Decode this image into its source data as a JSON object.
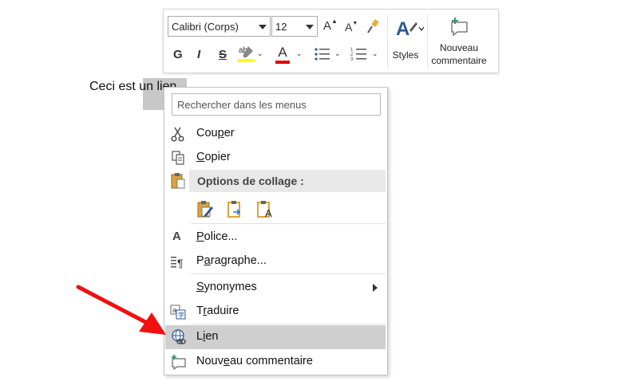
{
  "toolbar": {
    "font_name": "Calibri (Corps)",
    "font_size": "12",
    "grow_font": "A",
    "shrink_font": "A",
    "bold": "G",
    "italic": "I",
    "strike": "S",
    "font_color_letter": "A",
    "styles_label": "Styles",
    "new_comment_line1": "Nouveau",
    "new_comment_line2": "commentaire",
    "highlight_color": "#ffff00",
    "font_color": "#e00000"
  },
  "document": {
    "text_before": "Ceci est ",
    "text_selected": "un lien"
  },
  "menu": {
    "search_placeholder": "Rechercher dans les menus",
    "cut": [
      "Cou",
      "p",
      "er"
    ],
    "copy": [
      "",
      "C",
      "opier"
    ],
    "paste_header": "Options de collage :",
    "font": [
      "",
      "P",
      "olice..."
    ],
    "paragraph": [
      "P",
      "a",
      "ragraphe..."
    ],
    "synonyms": [
      "",
      "S",
      "ynonymes"
    ],
    "translate": [
      "T",
      "r",
      "aduire"
    ],
    "link": [
      "L",
      "i",
      "en"
    ],
    "new_comment": [
      "Nouv",
      "e",
      "au commentaire"
    ]
  },
  "annotation": {
    "arrow_color": "#f01010"
  }
}
